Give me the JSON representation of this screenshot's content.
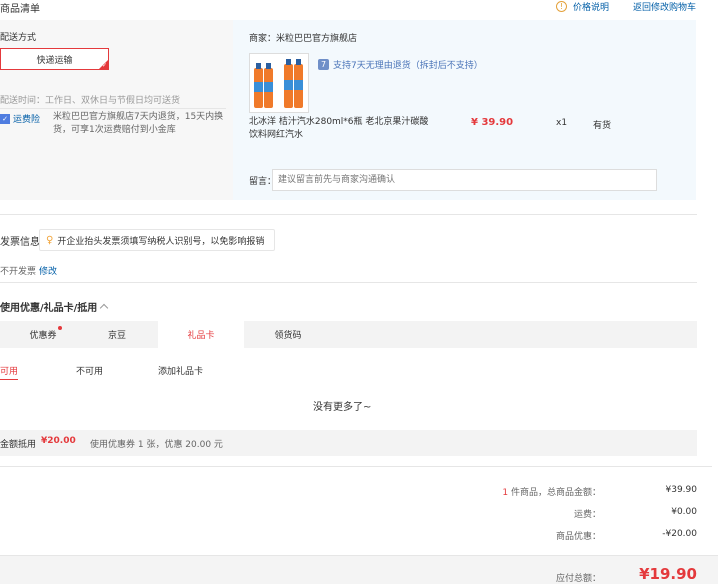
{
  "header": {
    "title": "商品清单",
    "price_note": "价格说明",
    "return_cart": "返回修改购物车"
  },
  "delivery": {
    "label": "配送方式",
    "method": "快递运输",
    "time": "配送时间：工作日、双休日与节假日均可送货",
    "freight_tag": "运费险",
    "freight_desc": "米粒巴巴官方旗舰店7天内退货，15天内换货，可享1次运费赔付到小金库"
  },
  "merchant": {
    "name": "商家：米粒巴巴官方旗舰店",
    "return_policy": "支持7天无理由退货（拆封后不支持）",
    "product_name": "北冰洋 桔汁汽水280ml*6瓶 老北京果汁碳酸饮料网红汽水",
    "price": "¥ 39.90",
    "qty": "x1",
    "stock": "有货",
    "note_label": "留言：",
    "note_placeholder": "建议留言前先与商家沟通确认"
  },
  "invoice": {
    "title": "发票信息",
    "tip": "开企业抬头发票须填写纳税人识别号，以免影响报销",
    "status": "不开发票",
    "edit": "修改"
  },
  "discount": {
    "title": "使用优惠/礼品卡/抵用",
    "tabs": [
      "优惠券",
      "京豆",
      "礼品卡",
      "领货码"
    ],
    "subtabs": [
      "可用",
      "不可用",
      "添加礼品卡"
    ],
    "empty": "没有更多了~",
    "deduct_label": "金额抵用",
    "deduct_amount": "¥20.00",
    "deduct_desc": "使用优惠券 1 张，优惠 20.00 元"
  },
  "totals": {
    "goods_count": "1",
    "goods_label": " 件商品，总商品金额：",
    "goods_value": "¥39.90",
    "ship_label": "运费：",
    "ship_value": "¥0.00",
    "discount_label": "商品优惠：",
    "discount_value": "-¥20.00",
    "pay_label": "应付总额：",
    "pay_value": "¥19.90"
  },
  "colors": {
    "accent": "#e4393c",
    "link": "#005ea7"
  }
}
